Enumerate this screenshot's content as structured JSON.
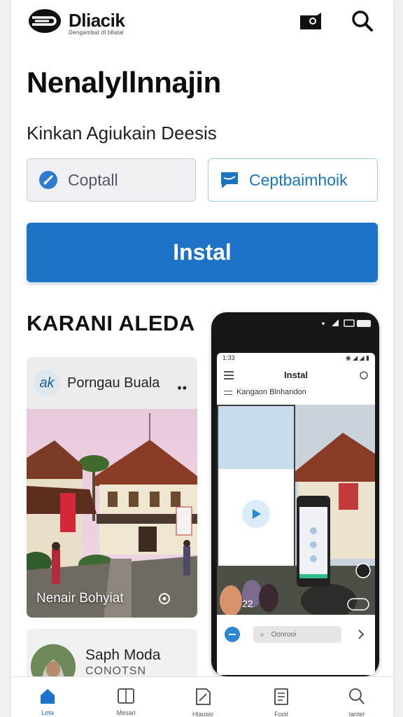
{
  "header": {
    "brand_name": "Dliacik",
    "brand_tagline": "Dengambat dl bllatal",
    "icons": [
      "camera-icon",
      "search-icon"
    ]
  },
  "hero": {
    "title": "Nenalyllnnajin",
    "subtitle": "Kinkan Agiukain Deesis",
    "chip_left_label": "Coptall",
    "chip_right_label": "Ceptbaimhoik",
    "install_label": "Instal"
  },
  "section": {
    "title": "KARANI ALEDA"
  },
  "card": {
    "avatar_text": "ak",
    "title": "Porngau Buala",
    "more": "••",
    "caption": "Nenair Bohyiat"
  },
  "card2": {
    "title": "Saph Moda",
    "subtitle": "CONOTSN"
  },
  "phone": {
    "status_time": "1:33",
    "screen_title": "Instal",
    "screen_subtitle": "Kangaon Blnhandon",
    "count": "22",
    "search_placeholder": "Oonrooi"
  },
  "colors": {
    "accent": "#1c73c7",
    "chip_right_border": "#9fcbe8",
    "chip_left_bg": "#eef0f4"
  },
  "nav": {
    "items": [
      {
        "label": "Leta",
        "icon": "home-icon"
      },
      {
        "label": "Mesari",
        "icon": "book-icon"
      },
      {
        "label": "Hlausio",
        "icon": "note-icon"
      },
      {
        "label": "Fooil",
        "icon": "document-icon"
      },
      {
        "label": "Ianter",
        "icon": "search-icon"
      }
    ]
  }
}
